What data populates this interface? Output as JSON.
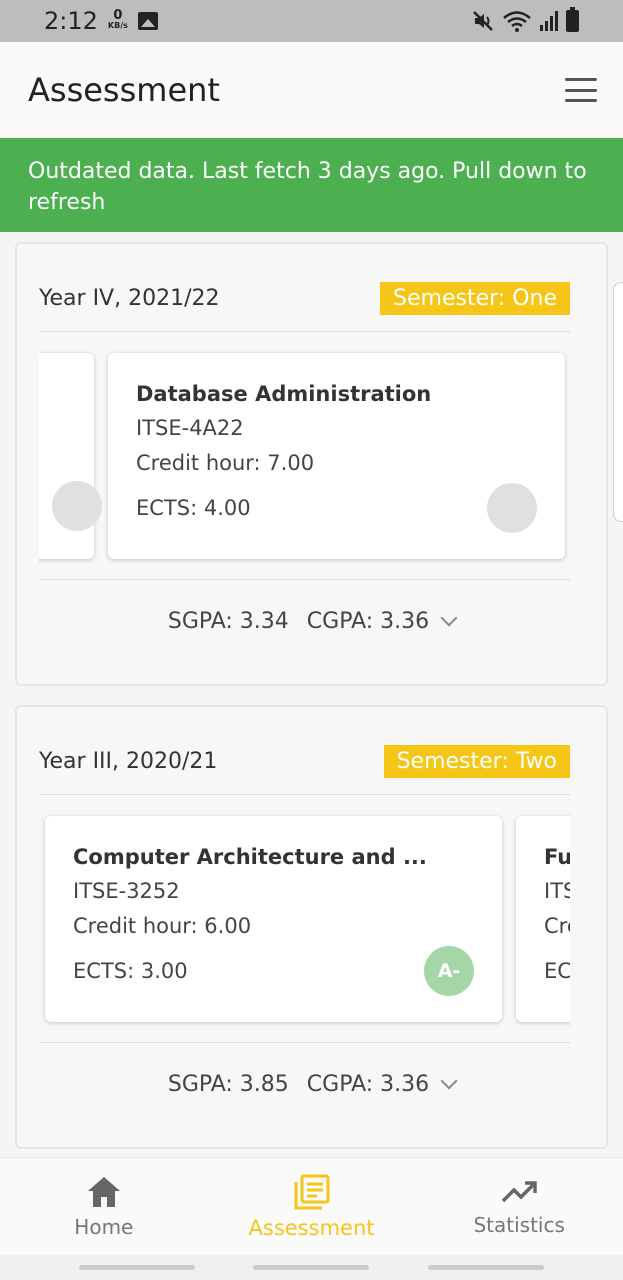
{
  "status_bar": {
    "time": "2:12",
    "net_speed": "0",
    "net_unit": "KB/s"
  },
  "app_bar": {
    "title": "Assessment"
  },
  "banner": {
    "text": "Outdated data. Last fetch 3 days ago. Pull down to refresh"
  },
  "years": [
    {
      "label": "Year IV, 2021/22",
      "semester": "Semester: One",
      "courses": [
        {
          "name": "Database Administration",
          "code": "ITSE-4A22",
          "credit": "Credit hour: 7.00",
          "ects": "ECTS: 4.00",
          "grade": ""
        }
      ],
      "sgpa": "SGPA: 3.34",
      "cgpa": "CGPA: 3.36"
    },
    {
      "label": "Year III, 2020/21",
      "semester": "Semester: Two",
      "courses": [
        {
          "name": "Computer Architecture and ...",
          "code": "ITSE-3252",
          "credit": "Credit hour: 6.00",
          "ects": "ECTS: 3.00",
          "grade": "A-"
        },
        {
          "name": "Fu",
          "code": "ITS",
          "credit": "Cre",
          "ects": "EC",
          "grade": ""
        }
      ],
      "sgpa": "SGPA: 3.85",
      "cgpa": "CGPA: 3.36"
    }
  ],
  "bottom_nav": {
    "items": [
      {
        "label": "Home",
        "icon": "home-icon"
      },
      {
        "label": "Assessment",
        "icon": "assessment-icon"
      },
      {
        "label": "Statistics",
        "icon": "trending-up-icon"
      }
    ],
    "active": "Assessment"
  },
  "colors": {
    "accent": "#f5c518",
    "banner": "#4caf50",
    "grade_green": "#a5d6a7"
  }
}
